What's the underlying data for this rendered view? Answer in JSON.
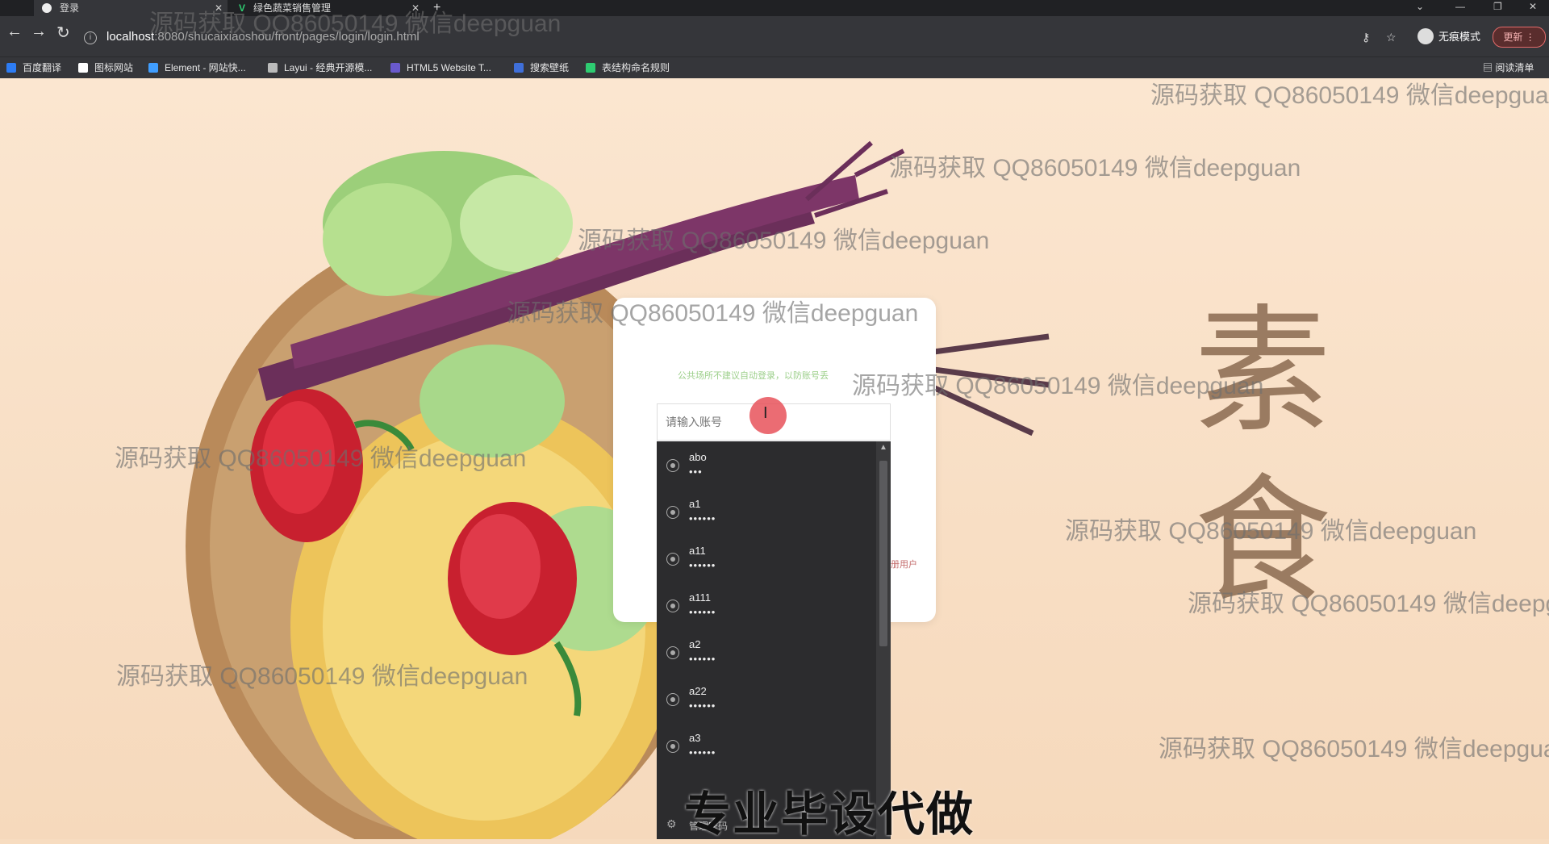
{
  "browser": {
    "tabs": [
      {
        "label": "登录",
        "active": true
      },
      {
        "label": "绿色蔬菜销售管理",
        "active": false
      }
    ],
    "new_tab_glyph": "+",
    "url_host": "localhost",
    "url_path": ":8080/shucaixiaoshou/front/pages/login/login.html",
    "incognito_label": "无痕模式",
    "update_label": "更新",
    "bookmarks": [
      {
        "label": "百度翻译",
        "color": "#2d7cf3"
      },
      {
        "label": "图标网站",
        "color": "#ffffff"
      },
      {
        "label": "Element - 网站快...",
        "color": "#409eff"
      },
      {
        "label": "Layui - 经典开源模...",
        "color": "#bbbbbb"
      },
      {
        "label": "HTML5 Website T...",
        "color": "#6a5acd"
      },
      {
        "label": "搜索壁纸",
        "color": "#3f6fd9"
      },
      {
        "label": "表结构命名规则",
        "color": "#2ecc71"
      }
    ],
    "reading_list_label": "阅读清单"
  },
  "page": {
    "big_chars": [
      "素",
      "食"
    ],
    "login": {
      "notice": "公共场所不建议自动登录，以防账号丢",
      "account_placeholder": "请输入账号",
      "register_link": "册用户"
    },
    "autofill": {
      "items": [
        {
          "user": "abo",
          "pass": "•••"
        },
        {
          "user": "a1",
          "pass": "••••••"
        },
        {
          "user": "a11",
          "pass": "••••••"
        },
        {
          "user": "a111",
          "pass": "••••••"
        },
        {
          "user": "a2",
          "pass": "••••••"
        },
        {
          "user": "a22",
          "pass": "••••••"
        },
        {
          "user": "a3",
          "pass": "••••••"
        }
      ],
      "manage_label": "管理密码"
    }
  },
  "watermark_text": "源码获取 QQ86050149 微信deepguan",
  "caption": "专业毕设代做"
}
